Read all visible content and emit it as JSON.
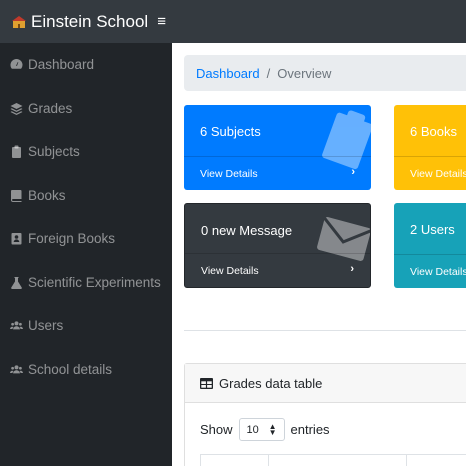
{
  "topbar": {
    "brand": "Einstein School",
    "menu_toggle": "≡"
  },
  "sidebar": {
    "items": [
      {
        "label": "Dashboard",
        "icon": "tachometer-icon"
      },
      {
        "label": "Grades",
        "icon": "layers-icon"
      },
      {
        "label": "Subjects",
        "icon": "clipboard-icon"
      },
      {
        "label": "Books",
        "icon": "book-icon"
      },
      {
        "label": "Foreign Books",
        "icon": "address-book-icon"
      },
      {
        "label": "Scientific Experiments",
        "icon": "flask-icon"
      },
      {
        "label": "Users",
        "icon": "users-icon"
      },
      {
        "label": "School details",
        "icon": "users-icon"
      }
    ]
  },
  "breadcrumb": {
    "link": "Dashboard",
    "separator": "/",
    "current": "Overview"
  },
  "cards": [
    {
      "title": "6 Subjects",
      "footer": "View Details",
      "color": "#007bff",
      "icon": "clipboard-icon"
    },
    {
      "title": "6 Books",
      "footer": "View Details",
      "color": "#ffc107",
      "icon": "book-icon"
    },
    {
      "title": "0 new Message",
      "footer": "View Details",
      "color": "#343a40",
      "icon": "envelope-icon"
    },
    {
      "title": "2 Users",
      "footer": "View Details",
      "color": "#17a2b8",
      "icon": "users-icon"
    }
  ],
  "table": {
    "title": "Grades data table",
    "show_label": "Show",
    "entries_value": "10",
    "entries_label": "entries"
  }
}
